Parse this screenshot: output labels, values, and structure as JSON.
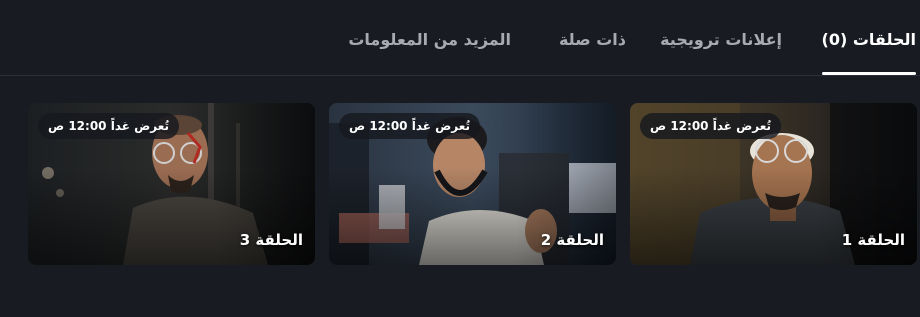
{
  "tabs": [
    {
      "label": "الحلقات (0)",
      "active": true
    },
    {
      "label": "إعلانات ترويجية",
      "active": false
    },
    {
      "label": "ذات صلة",
      "active": false
    },
    {
      "label": "المزيد من المعلومات",
      "active": false
    }
  ],
  "episodes": [
    {
      "title": "الحلقة 1",
      "badge": "تُعرض غداً 12:00 ص"
    },
    {
      "title": "الحلقة 2",
      "badge": "تُعرض غداً 12:00 ص"
    },
    {
      "title": "الحلقة 3",
      "badge": "تُعرض غداً 12:00 ص"
    }
  ],
  "colors": {
    "background": "#181b22",
    "active_tab": "#ffffff",
    "inactive_tab": "#a7aab2",
    "divider": "#2b2f39"
  }
}
